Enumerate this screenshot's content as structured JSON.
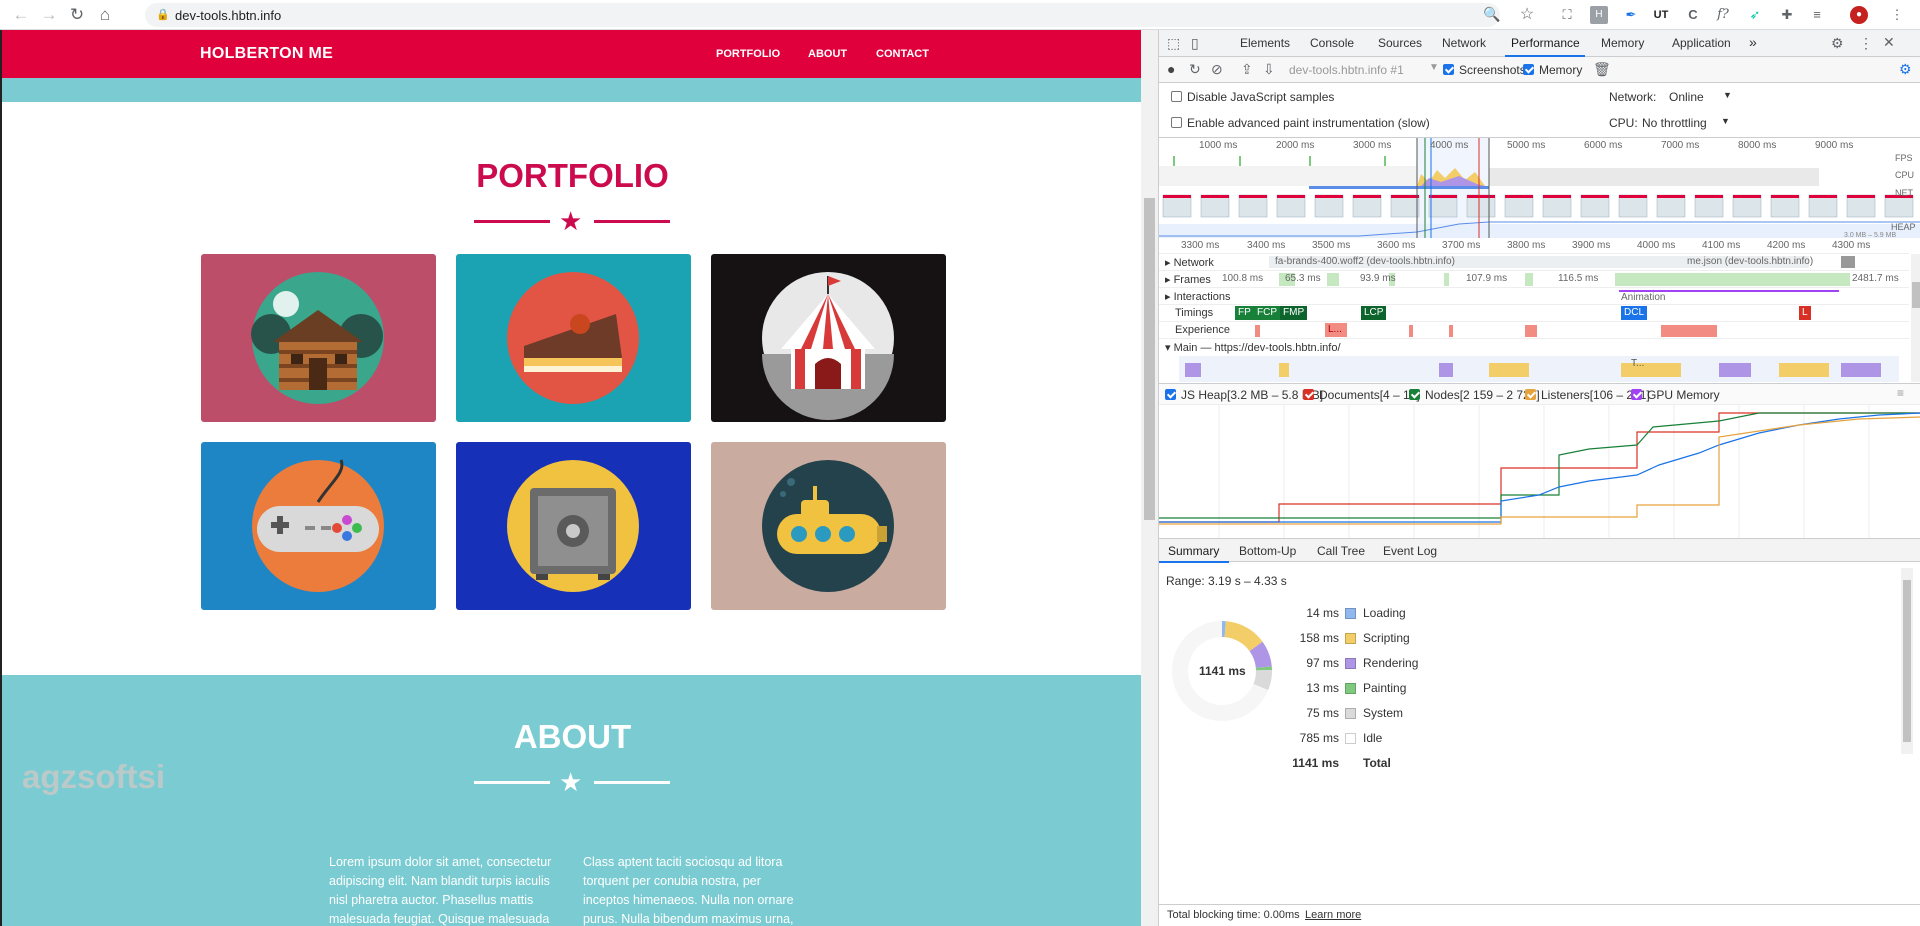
{
  "browser": {
    "url": "dev-tools.hbtn.info"
  },
  "site": {
    "brand": "HOLBERTON ME",
    "nav": [
      "PORTFOLIO",
      "ABOUT",
      "CONTACT"
    ],
    "portfolio_title": "PORTFOLIO",
    "about_title": "ABOUT",
    "about_col1": "Lorem ipsum dolor sit amet, consectetur adipiscing elit. Nam blandit turpis iaculis nisl pharetra auctor. Phasellus mattis malesuada feugiat. Quisque malesuada orci non risus",
    "about_col2": "Class aptent taciti sociosqu ad litora torquent per conubia nostra, per inceptos himenaeos. Nulla non ornare purus. Nulla bibendum maximus urna, sed finibus velit tristique vel. Vivamus",
    "watermark": "agzsoftsi",
    "colors": {
      "nav": "#e0003c",
      "teal": "#7accd2",
      "accent": "#cc0b4e"
    }
  },
  "devtools": {
    "tabs": [
      "Elements",
      "Console",
      "Sources",
      "Network",
      "Performance",
      "Memory",
      "Application"
    ],
    "active_tab": "Performance",
    "more_tabs": "»",
    "recording_select": "dev-tools.hbtn.info #1",
    "screenshots_label": "Screenshots",
    "memory_label": "Memory",
    "disable_js_samples": "Disable JavaScript samples",
    "advanced_paint": "Enable advanced paint instrumentation (slow)",
    "network_label": "Network:",
    "network_value": "Online",
    "cpu_label": "CPU:",
    "cpu_value": "No throttling",
    "overview_ticks": [
      "1000 ms",
      "2000 ms",
      "3000 ms",
      "4000 ms",
      "5000 ms",
      "6000 ms",
      "7000 ms",
      "8000 ms",
      "9000 ms"
    ],
    "overview_side_labels": [
      "FPS",
      "CPU",
      "NET",
      "HEAP"
    ],
    "heap_range": "3.0 MB – 5.9 MB",
    "ruler_ticks": [
      "3300 ms",
      "3400 ms",
      "3500 ms",
      "3600 ms",
      "3700 ms",
      "3800 ms",
      "3900 ms",
      "4000 ms",
      "4100 ms",
      "4200 ms",
      "4300 ms"
    ],
    "tracks": {
      "network": "Network",
      "network_item1": "fa-brands-400.woff2 (dev-tools.hbtn.info)",
      "network_item2": "me.json (dev-tools.hbtn.info)",
      "frames": "Frames",
      "frame_times": [
        "100.8 ms",
        "65.3 ms",
        "93.9 ms",
        "107.9 ms",
        "116.5 ms",
        "2481.7 ms"
      ],
      "interactions": "Interactions",
      "animation": "Animation",
      "timings": "Timings",
      "timing_marks": [
        "FP",
        "FCP",
        "FMP",
        "LCP",
        "DCL",
        "L"
      ],
      "experience": "Experience",
      "experience_mark": "L...",
      "main": "Main — https://dev-tools.hbtn.info/",
      "main_task": "T..."
    },
    "counters": [
      {
        "label": "JS Heap[3.2 MB – 5.8 MB]",
        "color": "#1a73e8"
      },
      {
        "label": "Documents[4 – 10]",
        "color": "#d93025"
      },
      {
        "label": "Nodes[2 159 – 2 723]",
        "color": "#188038"
      },
      {
        "label": "Listeners[106 – 221]",
        "color": "#e6a23c"
      },
      {
        "label": "GPU Memory",
        "color": "#a142f4"
      }
    ],
    "bottom_tabs": [
      "Summary",
      "Bottom-Up",
      "Call Tree",
      "Event Log"
    ],
    "summary": {
      "range": "Range: 3.19 s – 4.33 s",
      "total_center": "1141 ms",
      "rows": [
        {
          "value": "14 ms",
          "label": "Loading",
          "color": "#90b8ee",
          "ms": 14
        },
        {
          "value": "158 ms",
          "label": "Scripting",
          "color": "#f2cd68",
          "ms": 158
        },
        {
          "value": "97 ms",
          "label": "Rendering",
          "color": "#af95e6",
          "ms": 97
        },
        {
          "value": "13 ms",
          "label": "Painting",
          "color": "#7fc97f",
          "ms": 13
        },
        {
          "value": "75 ms",
          "label": "System",
          "color": "#dadada",
          "ms": 75
        },
        {
          "value": "785 ms",
          "label": "Idle",
          "color": "#ffffff",
          "ms": 785
        }
      ],
      "total_value": "1141 ms",
      "total_label": "Total"
    },
    "footer_text": "Total blocking time: 0.00ms",
    "footer_link": "Learn more"
  }
}
